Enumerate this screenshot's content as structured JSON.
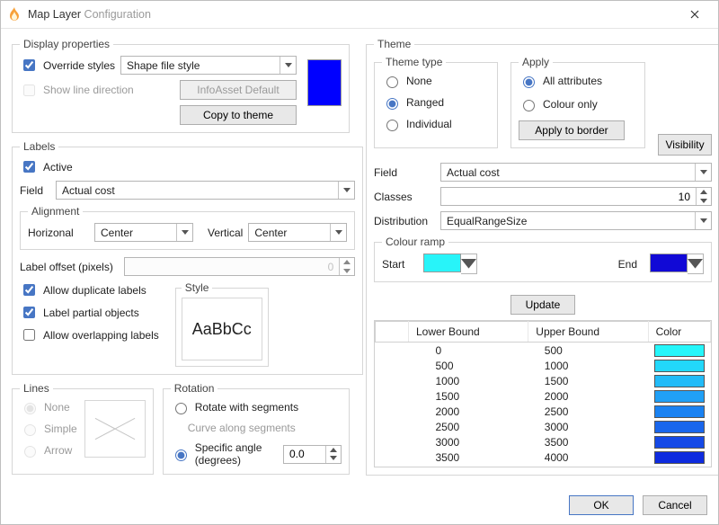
{
  "title": {
    "main": "Map Layer",
    "suffix": "Configuration"
  },
  "display_properties": {
    "legend": "Display properties",
    "override_label": "Override styles",
    "override_checked": true,
    "style_value": "Shape file style",
    "show_line_dir_label": "Show line direction",
    "show_line_dir_checked": false,
    "infoasset_btn": "InfoAsset Default",
    "copy_btn": "Copy to theme",
    "swatch_color": "#0000ff"
  },
  "labels": {
    "legend": "Labels",
    "active_label": "Active",
    "active_checked": true,
    "field_label": "Field",
    "field_value": "Actual cost",
    "alignment": {
      "legend": "Alignment",
      "h_label": "Horizonal",
      "h_value": "Center",
      "v_label": "Vertical",
      "v_value": "Center"
    },
    "offset_label": "Label offset (pixels)",
    "offset_value": "0",
    "allow_dup": "Allow duplicate labels",
    "label_partial": "Label partial objects",
    "allow_overlap": "Allow overlapping labels",
    "style_legend": "Style",
    "style_preview": "AaBbCc"
  },
  "lines": {
    "legend": "Lines",
    "none": "None",
    "simple": "Simple",
    "arrow": "Arrow"
  },
  "rotation": {
    "legend": "Rotation",
    "with_segments": "Rotate with segments",
    "curve": "Curve along segments",
    "angle_label": "Specific angle (degrees)",
    "angle_value": "0.0"
  },
  "theme": {
    "legend": "Theme",
    "type_legend": "Theme type",
    "type_none": "None",
    "type_ranged": "Ranged",
    "type_individual": "Individual",
    "type_selected": "Ranged",
    "apply_legend": "Apply",
    "apply_all": "All attributes",
    "apply_colour": "Colour only",
    "apply_border_btn": "Apply to border",
    "visibility_btn": "Visibility",
    "field_label": "Field",
    "field_value": "Actual cost",
    "classes_label": "Classes",
    "classes_value": "10",
    "dist_label": "Distribution",
    "dist_value": "EqualRangeSize",
    "ramp_legend": "Colour ramp",
    "ramp_start_label": "Start",
    "ramp_start_color": "#28f4f9",
    "ramp_end_label": "End",
    "ramp_end_color": "#1109d6",
    "update_btn": "Update",
    "headers": {
      "lb": "Lower Bound",
      "ub": "Upper Bound",
      "color": "Color"
    },
    "rows": [
      {
        "lb": "0",
        "ub": "500",
        "color": "#25f6fa"
      },
      {
        "lb": "500",
        "ub": "1000",
        "color": "#22d8fb"
      },
      {
        "lb": "1000",
        "ub": "1500",
        "color": "#22bbf8"
      },
      {
        "lb": "1500",
        "ub": "2000",
        "color": "#20a0f6"
      },
      {
        "lb": "2000",
        "ub": "2500",
        "color": "#1a82f2"
      },
      {
        "lb": "2500",
        "ub": "3000",
        "color": "#1966ec"
      },
      {
        "lb": "3000",
        "ub": "3500",
        "color": "#1549e6"
      },
      {
        "lb": "3500",
        "ub": "4000",
        "color": "#0e2bdf"
      }
    ]
  },
  "footer": {
    "ok": "OK",
    "cancel": "Cancel"
  },
  "chart_data": {
    "type": "table",
    "title": "Colour ramp classes",
    "columns": [
      "Lower Bound",
      "Upper Bound",
      "Color"
    ],
    "x": [
      0,
      500,
      1000,
      1500,
      2000,
      2500,
      3000,
      3500
    ],
    "series": [
      {
        "name": "Upper Bound",
        "values": [
          500,
          1000,
          1500,
          2000,
          2500,
          3000,
          3500,
          4000
        ]
      }
    ],
    "colors": [
      "#25f6fa",
      "#22d8fb",
      "#22bbf8",
      "#20a0f6",
      "#1a82f2",
      "#1966ec",
      "#1549e6",
      "#0e2bdf"
    ]
  }
}
